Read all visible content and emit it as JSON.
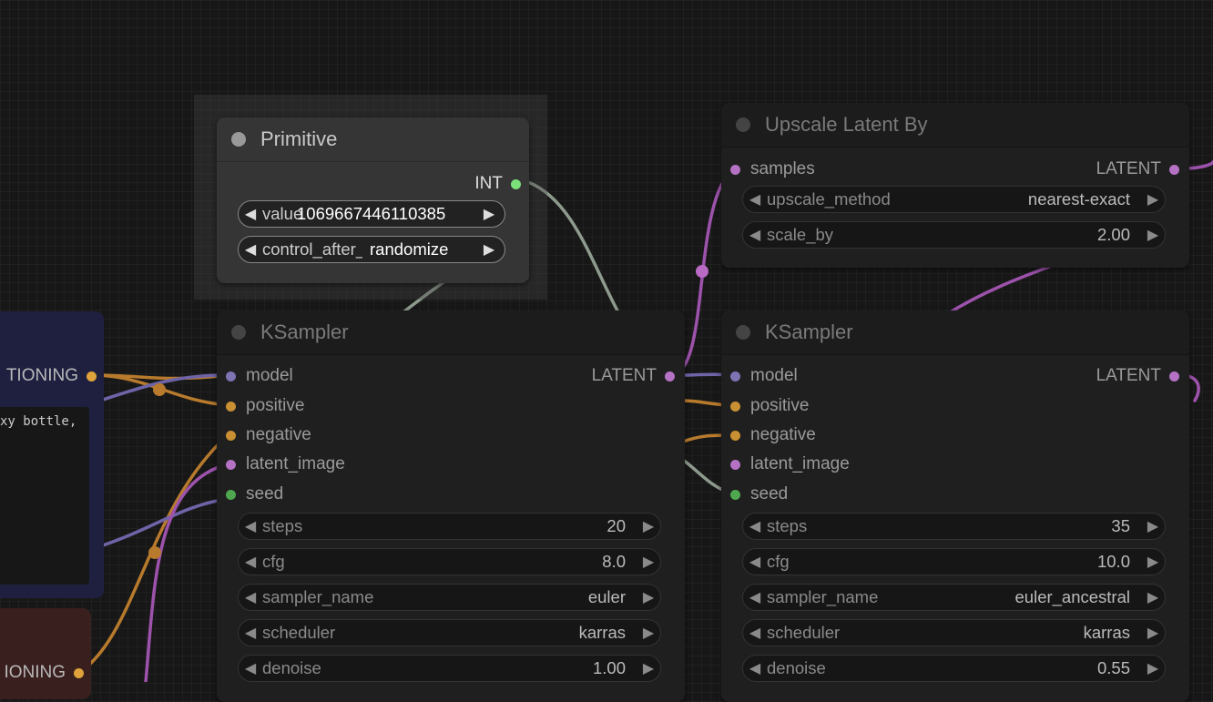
{
  "colors": {
    "canvas": "#171717",
    "link_conditioning": "#e8a13c",
    "link_latent": "#c96ad8",
    "link_model": "#9b8fe0",
    "link_int": "#b6c5b6",
    "slot_model": "#8a80c8",
    "slot_conditioning": "#e0a23a",
    "slot_latent": "#d07fe0",
    "slot_int": "#7ae07a"
  },
  "left_partial": {
    "conditioning_label": "TIONING",
    "text_snippet": "xy bottle,",
    "conditioning_label_2": "IONING"
  },
  "primitive": {
    "title": "Primitive",
    "output": "INT",
    "widgets": [
      {
        "label": "value",
        "value": "1069667446110385"
      },
      {
        "label": "control_after_generate",
        "value": "randomize"
      }
    ]
  },
  "upscale": {
    "title": "Upscale Latent By",
    "input": "samples",
    "output": "LATENT",
    "widgets": [
      {
        "label": "upscale_method",
        "value": "nearest-exact"
      },
      {
        "label": "scale_by",
        "value": "2.00"
      }
    ]
  },
  "ksampler1": {
    "title": "KSampler",
    "inputs": [
      "model",
      "positive",
      "negative",
      "latent_image",
      "seed"
    ],
    "output": "LATENT",
    "widgets": [
      {
        "label": "steps",
        "value": "20"
      },
      {
        "label": "cfg",
        "value": "8.0"
      },
      {
        "label": "sampler_name",
        "value": "euler"
      },
      {
        "label": "scheduler",
        "value": "karras"
      },
      {
        "label": "denoise",
        "value": "1.00"
      }
    ]
  },
  "ksampler2": {
    "title": "KSampler",
    "inputs": [
      "model",
      "positive",
      "negative",
      "latent_image",
      "seed"
    ],
    "output": "LATENT",
    "widgets": [
      {
        "label": "steps",
        "value": "35"
      },
      {
        "label": "cfg",
        "value": "10.0"
      },
      {
        "label": "sampler_name",
        "value": "euler_ancestral"
      },
      {
        "label": "scheduler",
        "value": "karras"
      },
      {
        "label": "denoise",
        "value": "0.55"
      }
    ]
  }
}
